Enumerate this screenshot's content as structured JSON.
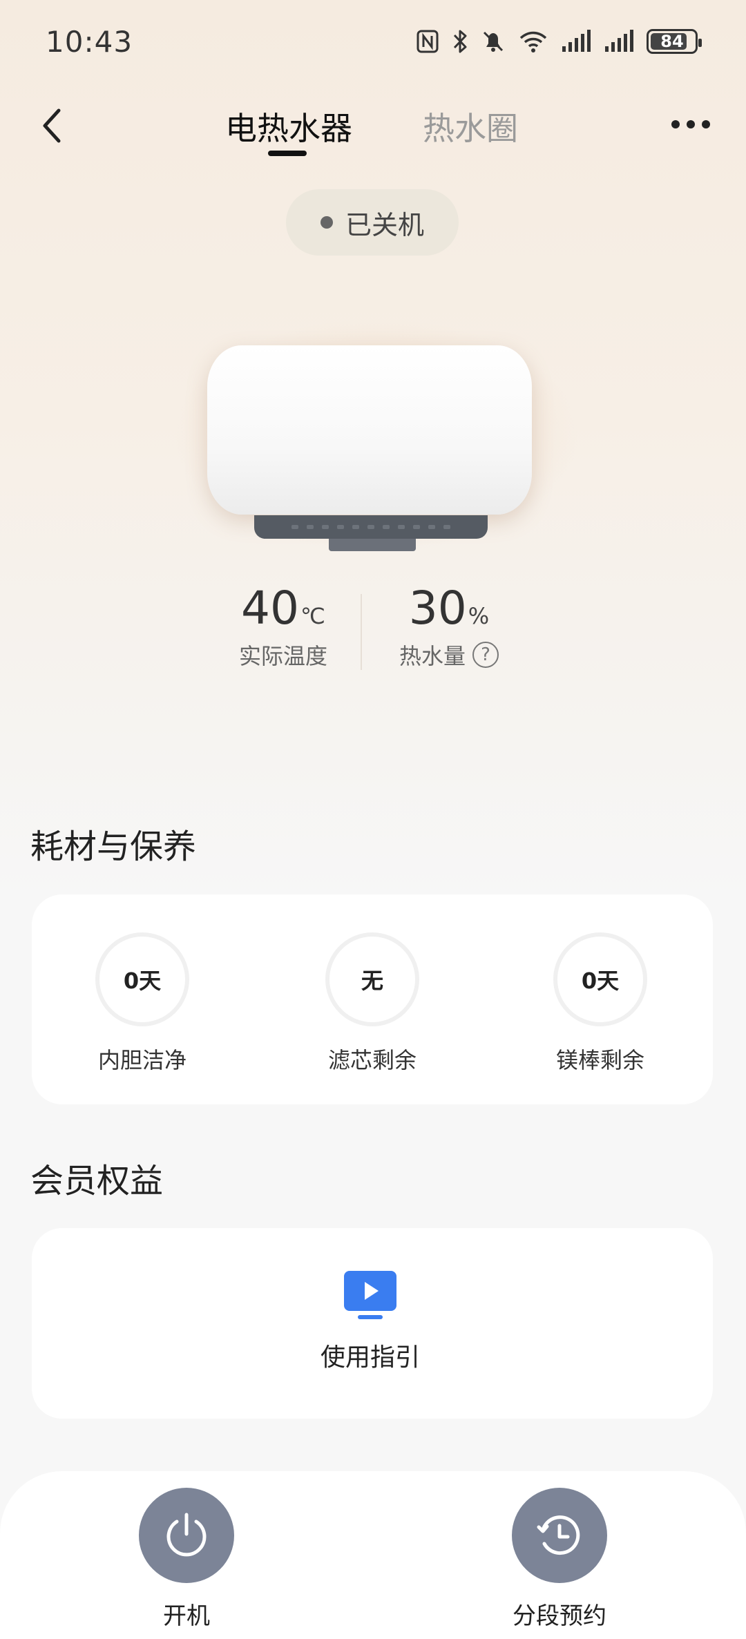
{
  "status_bar": {
    "time": "10:43",
    "battery": "84",
    "battery_level": 84
  },
  "header": {
    "tabs": [
      {
        "label": "电热水器",
        "active": true
      },
      {
        "label": "热水圈",
        "active": false
      }
    ]
  },
  "device": {
    "state": "已关机"
  },
  "metrics": {
    "temperature": {
      "value": "40",
      "unit": "℃",
      "label": "实际温度"
    },
    "hot_water": {
      "value": "30",
      "unit": "%",
      "label": "热水量"
    }
  },
  "consumables": {
    "title": "耗材与保养",
    "items": [
      {
        "value": "0天",
        "label": "内胆洁净"
      },
      {
        "value": "无",
        "label": "滤芯剩余"
      },
      {
        "value": "0天",
        "label": "镁棒剩余"
      }
    ]
  },
  "member": {
    "title": "会员权益",
    "guide_label": "使用指引"
  },
  "bottom_bar": {
    "power_label": "开机",
    "schedule_label": "分段预约"
  },
  "colors": {
    "accent_blue": "#3a7df0",
    "button_gray": "#7c8497",
    "pill_bg": "#ece7dc"
  }
}
